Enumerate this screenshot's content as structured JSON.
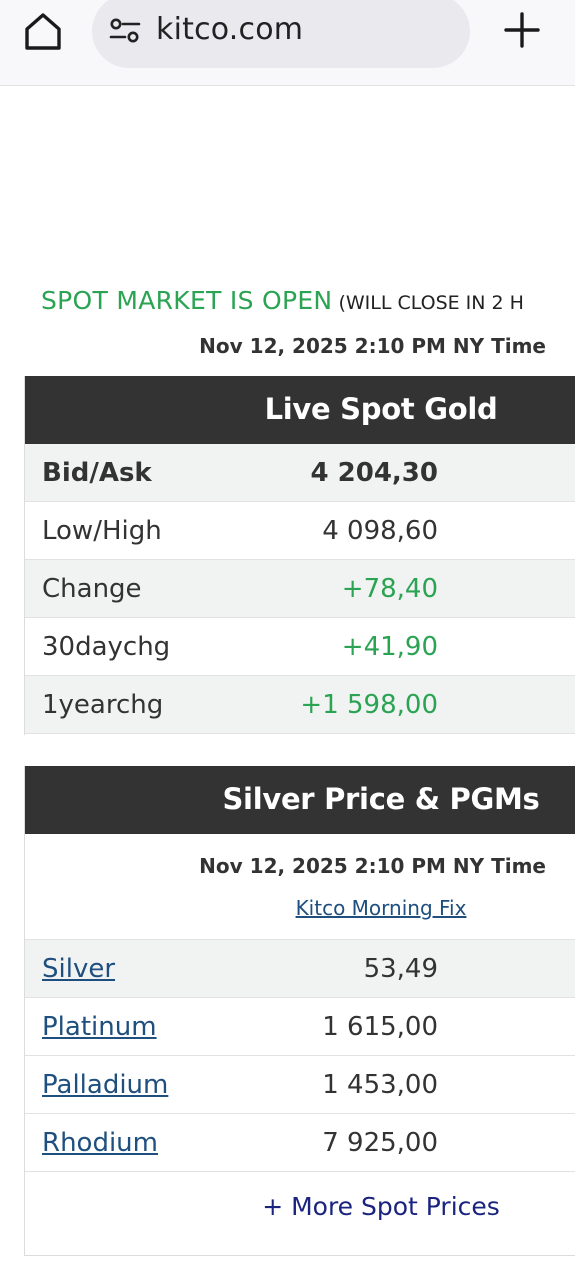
{
  "browser": {
    "url": "kitco.com",
    "icons": {
      "home": "home-icon",
      "site_settings": "tune-icon",
      "new_tab": "plus-icon"
    }
  },
  "status": {
    "open_text": "SPOT MARKET IS OPEN",
    "close_text": "(WILL CLOSE IN 2 H",
    "timestamp": "Nov 12, 2025 2:10 PM NY Time"
  },
  "gold": {
    "title": "Live Spot Gold",
    "rows": [
      {
        "label": "Bid/Ask",
        "value": "4 204,30"
      },
      {
        "label": "Low/High",
        "value": "4 098,60"
      },
      {
        "label": "Change",
        "value": "+78,40"
      },
      {
        "label": "30daychg",
        "value": "+41,90"
      },
      {
        "label": "1yearchg",
        "value": "+1 598,00"
      }
    ]
  },
  "silver": {
    "title": "Silver Price & PGMs",
    "timestamp": "Nov 12, 2025 2:10 PM NY Time",
    "fix_link": "Kitco Morning Fix",
    "rows": [
      {
        "label": "Silver",
        "value": "53,49"
      },
      {
        "label": "Platinum",
        "value": "1 615,00"
      },
      {
        "label": "Palladium",
        "value": "1 453,00"
      },
      {
        "label": "Rhodium",
        "value": "7 925,00"
      }
    ],
    "more_link": "+ More Spot Prices"
  },
  "colors": {
    "accent_green": "#2aa352",
    "header_bg": "#333333",
    "link_blue": "#1e4f7e",
    "more_link": "#1a237e"
  }
}
